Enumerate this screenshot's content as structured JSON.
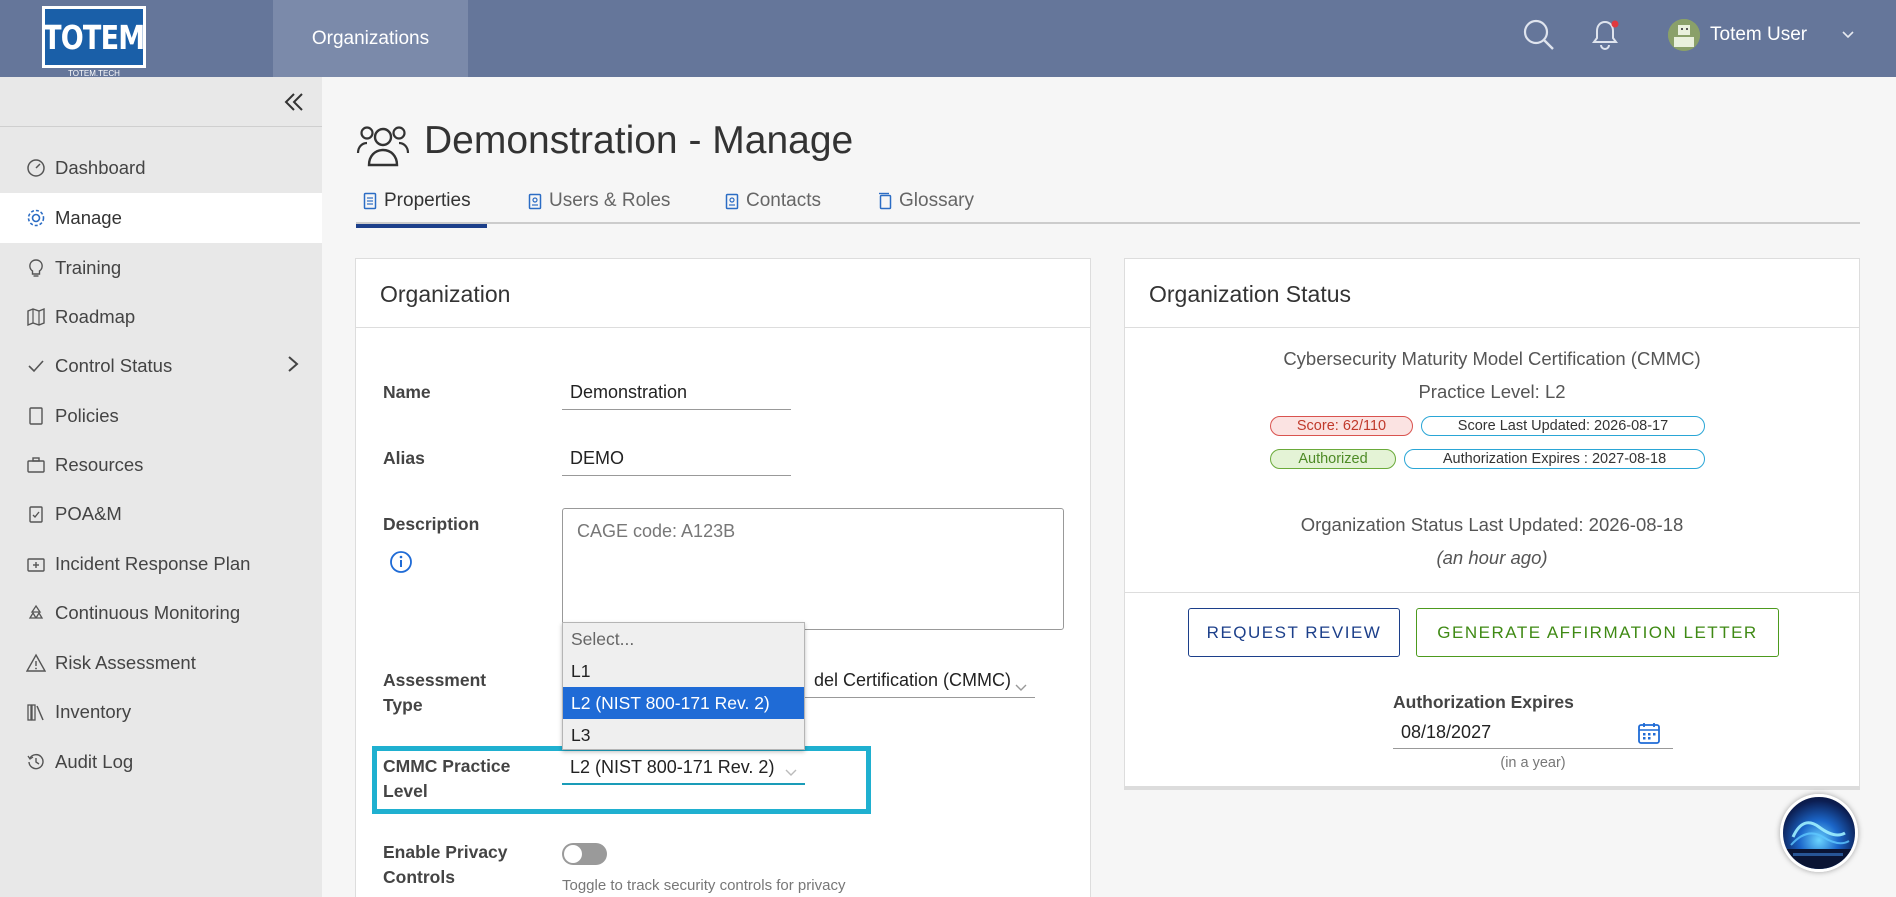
{
  "brand": {
    "logo_text": "TOTEM",
    "logo_sub": "TOTEM.TECH"
  },
  "topnav": {
    "organizations": "Organizations"
  },
  "user": {
    "name": "Totem User"
  },
  "sidebar": {
    "items": [
      {
        "label": "Dashboard",
        "icon": "speedometer-icon"
      },
      {
        "label": "Manage",
        "icon": "gear-icon"
      },
      {
        "label": "Training",
        "icon": "lightbulb-icon"
      },
      {
        "label": "Roadmap",
        "icon": "map-icon"
      },
      {
        "label": "Control Status",
        "icon": "checkmark-icon"
      },
      {
        "label": "Policies",
        "icon": "document-icon"
      },
      {
        "label": "Resources",
        "icon": "briefcase-icon"
      },
      {
        "label": "POA&M",
        "icon": "clipboard-check-icon"
      },
      {
        "label": "Incident Response Plan",
        "icon": "first-aid-icon"
      },
      {
        "label": "Continuous Monitoring",
        "icon": "recycle-icon"
      },
      {
        "label": "Risk Assessment",
        "icon": "warning-icon"
      },
      {
        "label": "Inventory",
        "icon": "books-icon"
      },
      {
        "label": "Audit Log",
        "icon": "history-icon"
      }
    ]
  },
  "page": {
    "title": "Demonstration - Manage",
    "tabs": [
      {
        "label": "Properties",
        "icon": "document-icon"
      },
      {
        "label": "Users & Roles",
        "icon": "id-badge-icon"
      },
      {
        "label": "Contacts",
        "icon": "id-badge-icon"
      },
      {
        "label": "Glossary",
        "icon": "copy-icon"
      }
    ]
  },
  "org_card": {
    "title": "Organization",
    "name_label": "Name",
    "name_value": "Demonstration",
    "alias_label": "Alias",
    "alias_value": "DEMO",
    "description_label": "Description",
    "description_value": "CAGE code: A123B",
    "assessment_label_1": "Assessment",
    "assessment_label_2": "Type",
    "assessment_value_partial": "del Certification (CMMC)",
    "dropdown_options": [
      "Select...",
      "L1",
      "L2 (NIST 800-171 Rev. 2)",
      "L3"
    ],
    "cmmc_label_1": "CMMC Practice",
    "cmmc_label_2": "Level",
    "cmmc_value": "L2 (NIST 800-171 Rev. 2)",
    "privacy_label_1": "Enable Privacy",
    "privacy_label_2": "Controls",
    "privacy_helper": "Toggle to track security controls for privacy"
  },
  "status_card": {
    "title": "Organization Status",
    "framework": "Cybersecurity Maturity Model Certification (CMMC)",
    "practice_level": "Practice Level: L2",
    "score_pill": "Score: 62/110",
    "score_updated_pill": "Score Last Updated: 2026-08-17",
    "authorized_pill": "Authorized",
    "auth_expires_pill": "Authorization Expires : 2027-08-18",
    "last_updated": "Organization Status Last Updated: 2026-08-18",
    "relative_time": "(an hour ago)",
    "request_review": "REQUEST REVIEW",
    "generate_letter": "GENERATE AFFIRMATION LETTER",
    "auth_expires_label": "Authorization Expires",
    "auth_expires_value": "08/18/2027",
    "auth_expires_hint": "(in a year)"
  },
  "colors": {
    "header": "#65769a",
    "active_tab": "#1c3f8a",
    "highlight": "#1fb0d0",
    "score_pill": "#d9534f",
    "info_pill": "#2aa6d6",
    "authorized": "#6aaa3a"
  }
}
